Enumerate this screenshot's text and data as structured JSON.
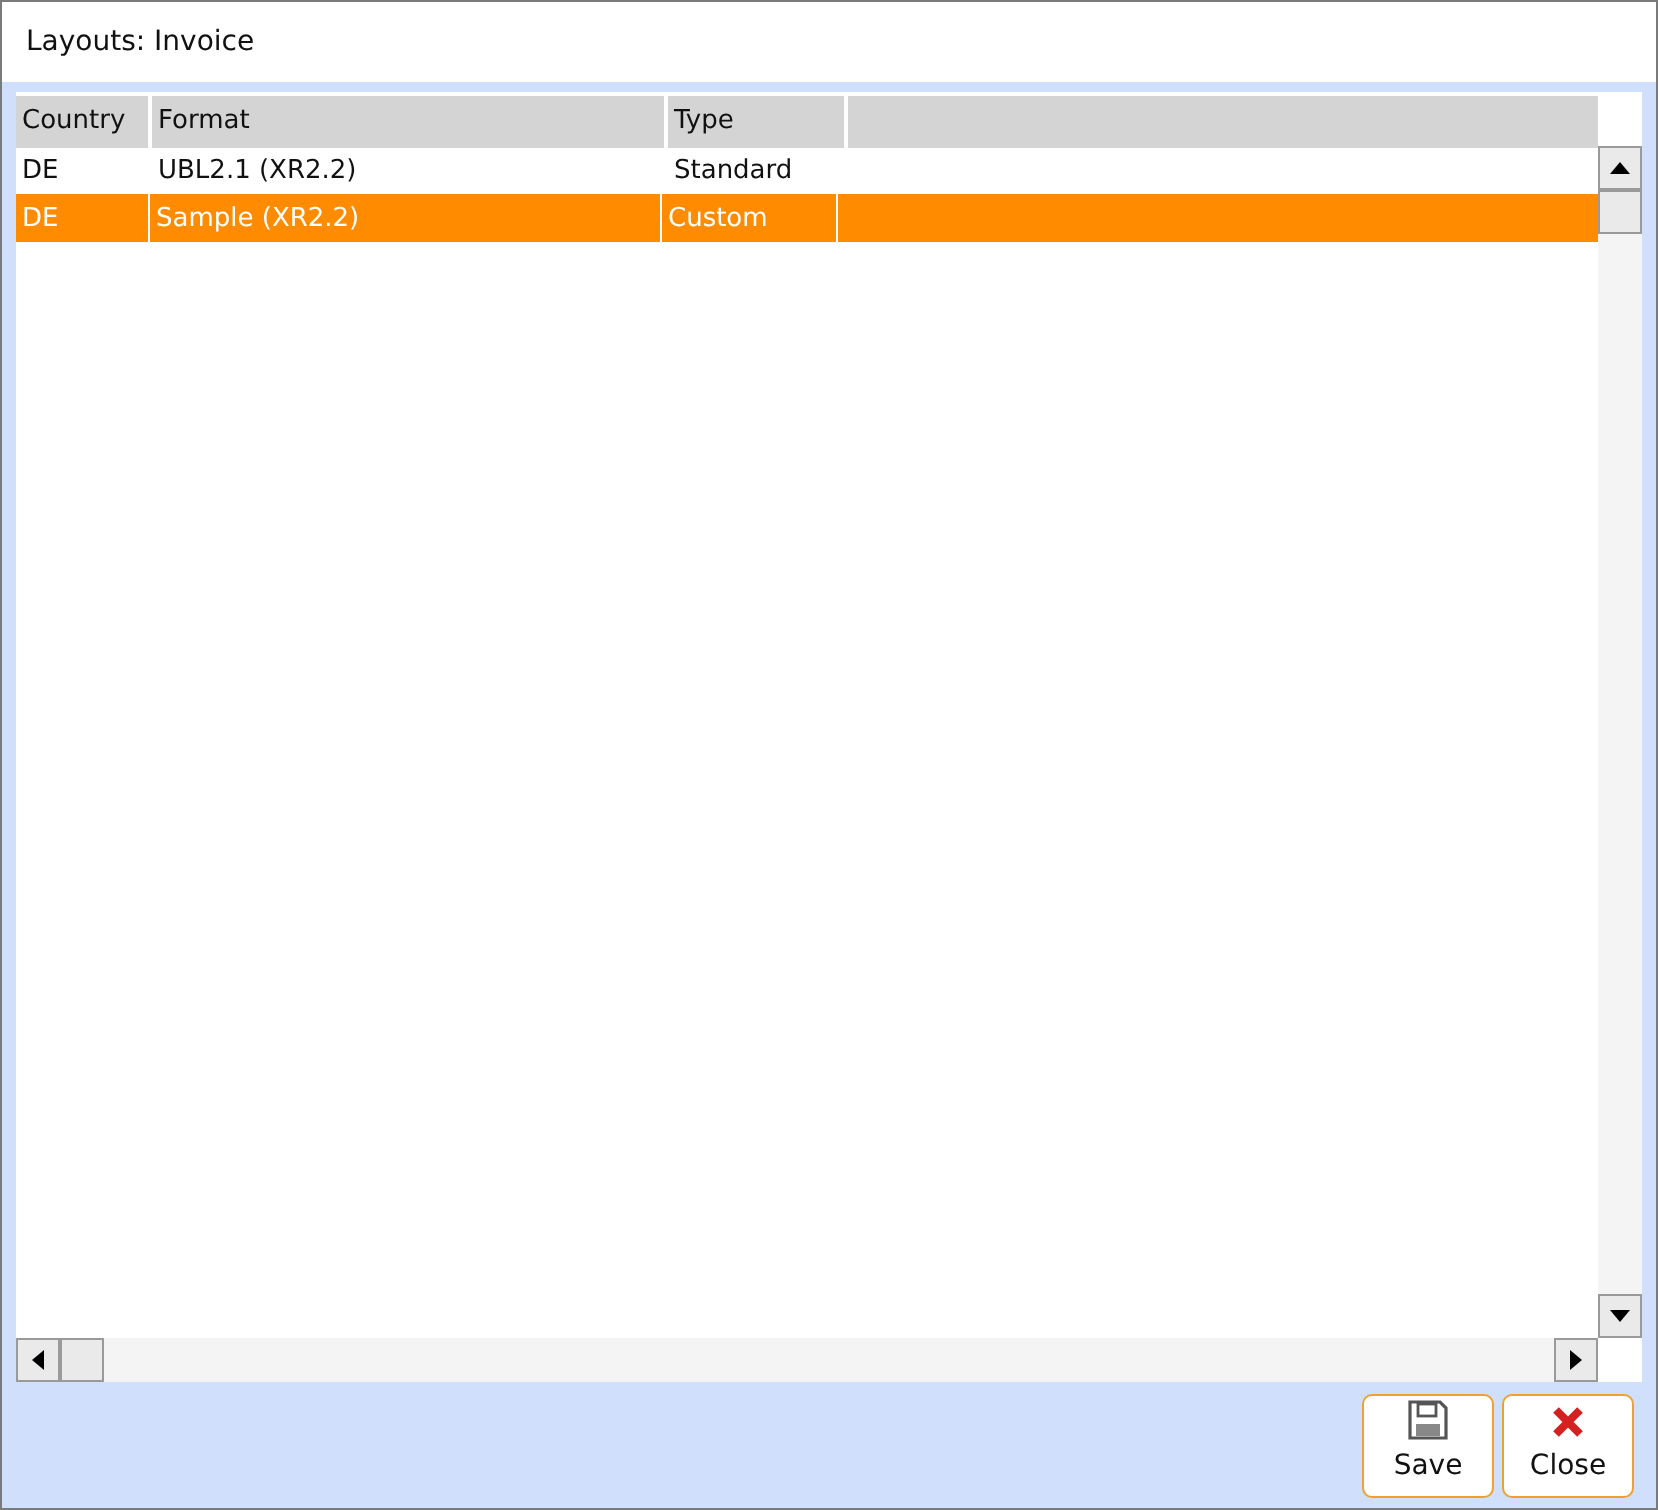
{
  "window": {
    "title": "Layouts: Invoice"
  },
  "table": {
    "columns": [
      "Country",
      "Format",
      "Type"
    ],
    "rows": [
      {
        "cells": [
          "DE",
          "UBL2.1 (XR2.2)",
          "Standard"
        ],
        "selected": false
      },
      {
        "cells": [
          "DE",
          "Sample (XR2.2)",
          "Custom"
        ],
        "selected": true
      }
    ]
  },
  "buttons": [
    {
      "kind": "save",
      "label": "Save"
    },
    {
      "kind": "close",
      "label": "Close"
    }
  ]
}
